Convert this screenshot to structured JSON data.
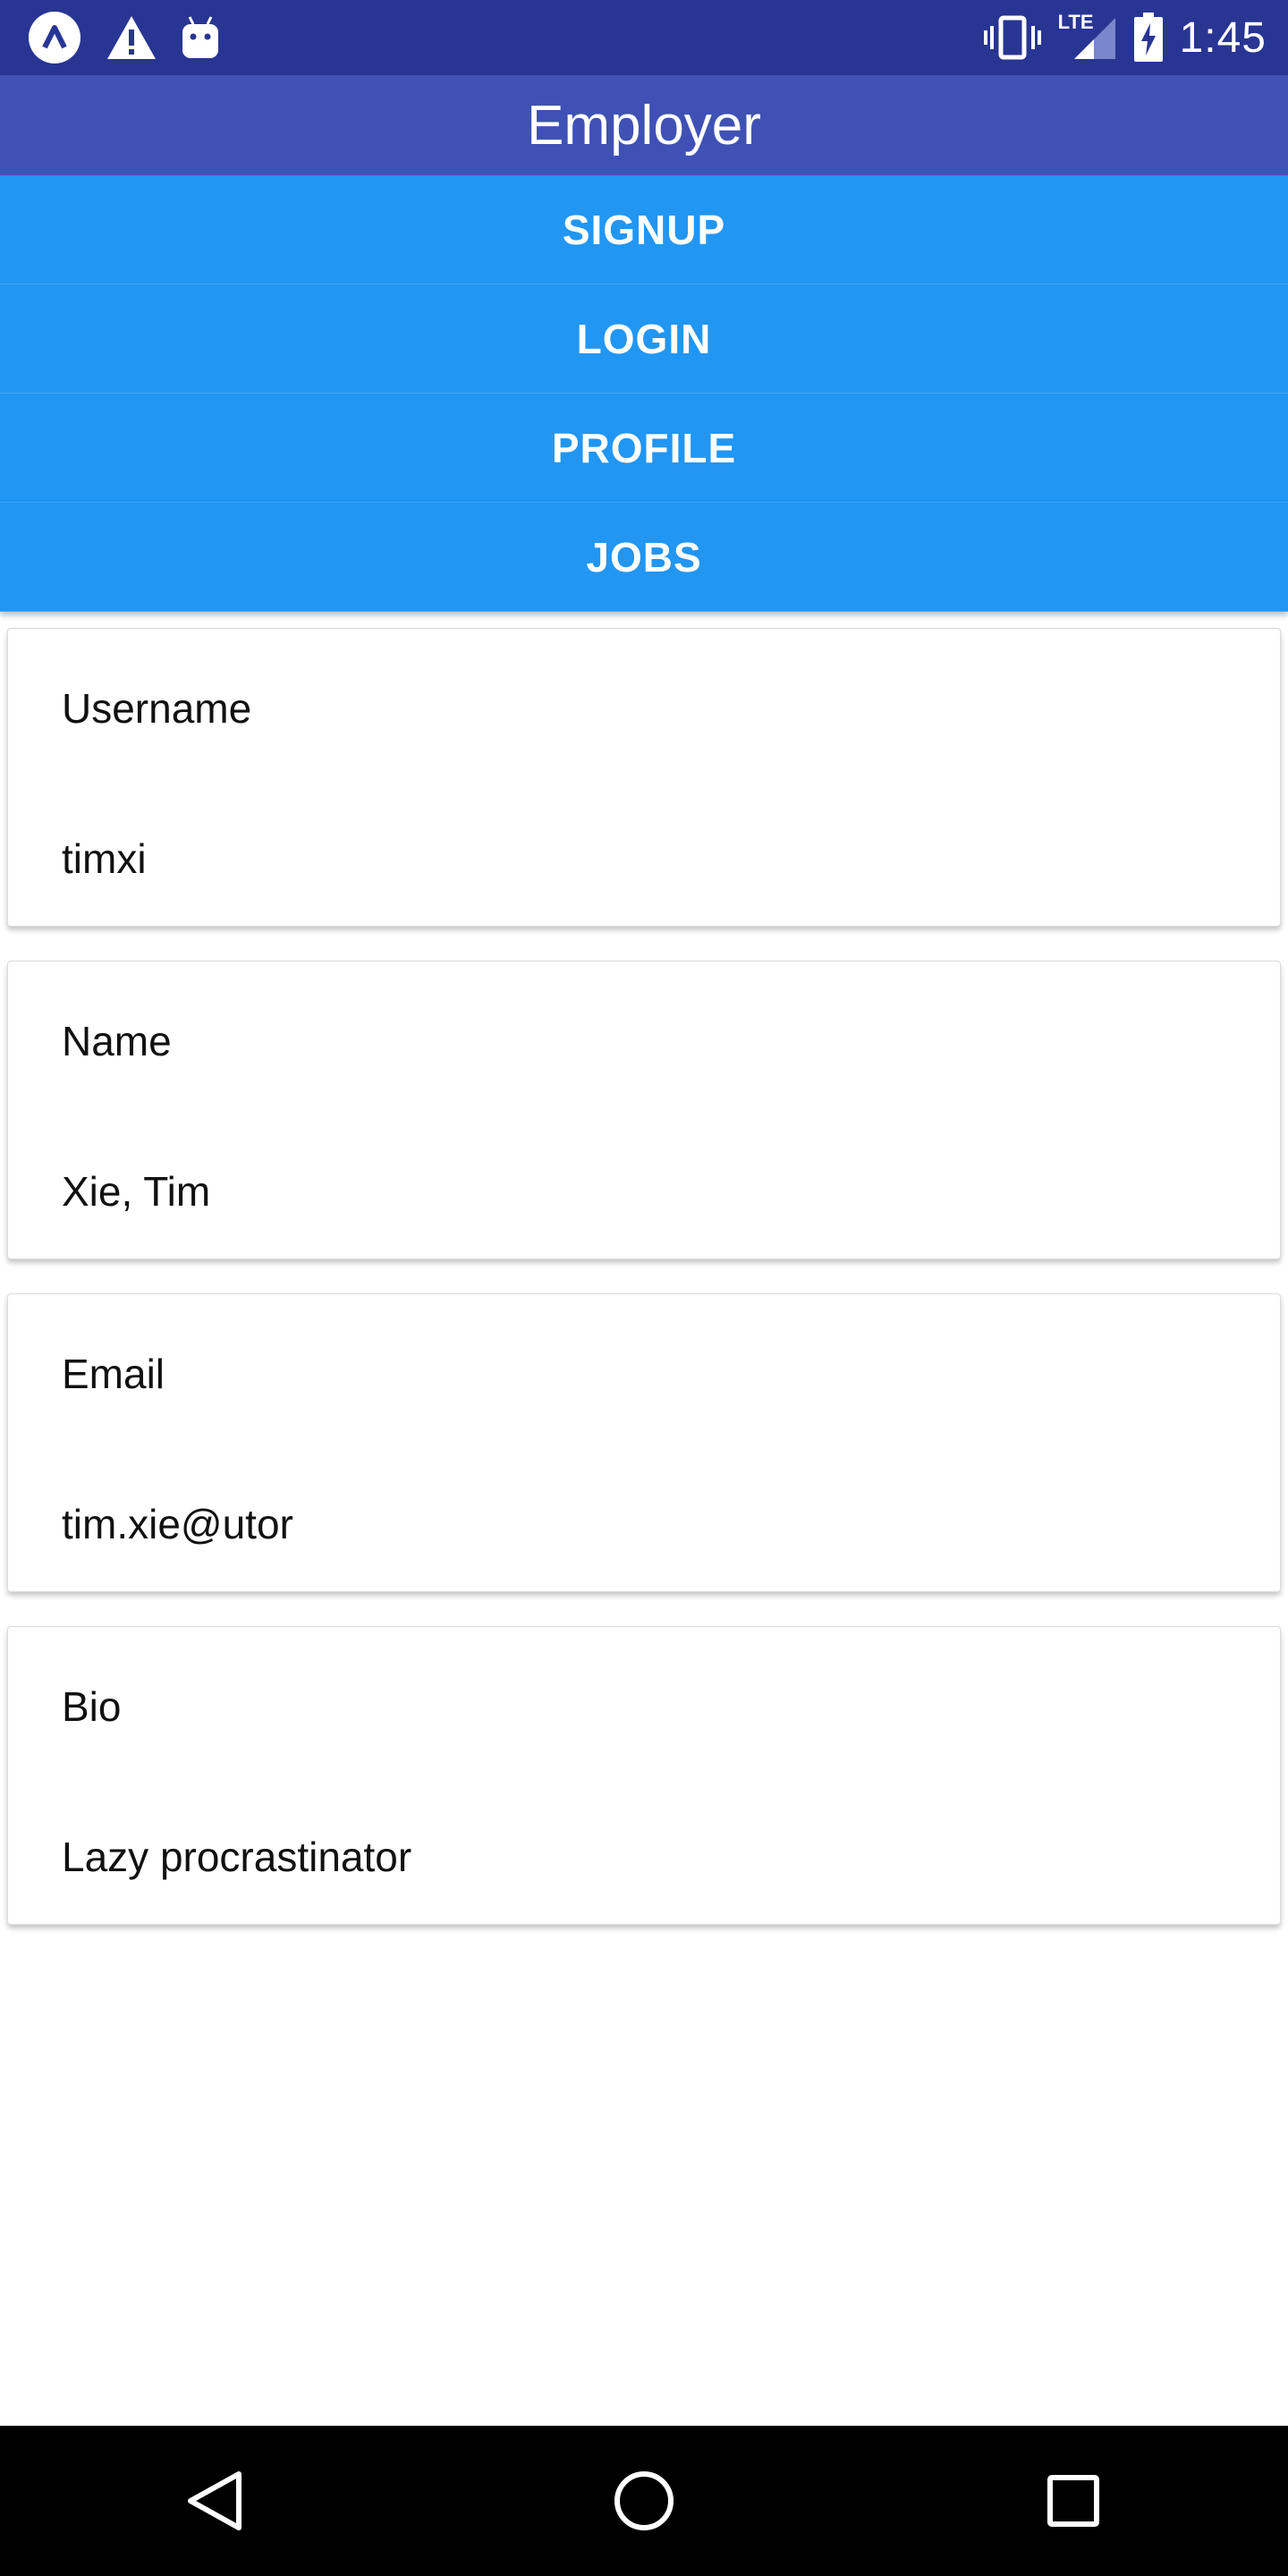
{
  "status_bar": {
    "time": "1:45",
    "icons_left": [
      "app-logo-icon",
      "warning-icon",
      "android-icon"
    ],
    "icons_right": [
      "vibrate-icon",
      "lte-signal-icon",
      "battery-charging-icon"
    ],
    "network_label": "LTE"
  },
  "app_bar": {
    "title": "Employer"
  },
  "nav": {
    "buttons": [
      {
        "label": "SIGNUP"
      },
      {
        "label": "LOGIN"
      },
      {
        "label": "PROFILE"
      },
      {
        "label": "JOBS"
      }
    ]
  },
  "profile": {
    "fields": [
      {
        "label": "Username",
        "value": "timxi"
      },
      {
        "label": "Name",
        "value": "Xie, Tim"
      },
      {
        "label": "Email",
        "value": "tim.xie@utor"
      },
      {
        "label": "Bio",
        "value": "Lazy procrastinator"
      }
    ]
  },
  "system_nav": {
    "buttons": [
      "back-icon",
      "home-icon",
      "recents-icon"
    ]
  },
  "colors": {
    "status_bar": "#283593",
    "app_bar": "#3f51b5",
    "nav_button": "#2196f3"
  }
}
